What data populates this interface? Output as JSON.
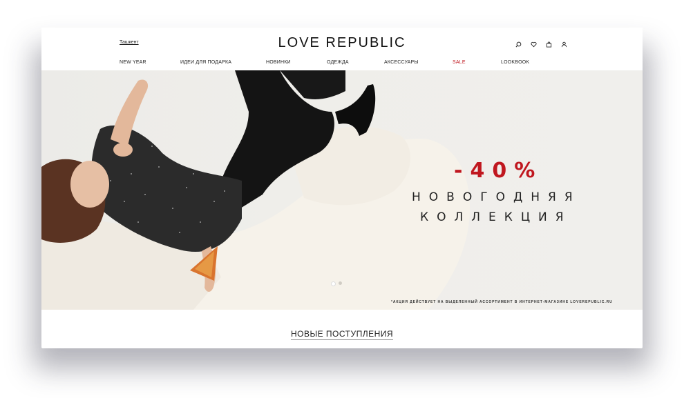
{
  "header": {
    "city": "Ташкент",
    "logo": "LOVE REPUBLIC"
  },
  "icons": [
    "search-icon",
    "heart-icon",
    "bag-icon",
    "user-icon"
  ],
  "nav": [
    {
      "label": "NEW YEAR",
      "sale": false
    },
    {
      "label": "ИДЕИ ДЛЯ ПОДАРКА",
      "sale": false
    },
    {
      "label": "НОВИНКИ",
      "sale": false
    },
    {
      "label": "ОДЕЖДА",
      "sale": false
    },
    {
      "label": "АКСЕССУАРЫ",
      "sale": false
    },
    {
      "label": "SALE",
      "sale": true
    },
    {
      "label": "LOOKBOOK",
      "sale": false
    }
  ],
  "banner": {
    "discount": "-40%",
    "line1": "НОВОГОДНЯЯ",
    "line2": "КОЛЛЕКЦИЯ",
    "disclaimer": "*АКЦИЯ ДЕЙСТВУЕТ НА ВЫДЕЛЕННЫЙ АССОРТИМЕНТ В ИНТЕРНЕТ-МАГАЗИНЕ LOVEREPUBLIC.RU",
    "slides": 2,
    "active_slide": 1
  },
  "section": {
    "title": "НОВЫЕ ПОСТУПЛЕНИЯ"
  },
  "colors": {
    "accent_red": "#c0171f",
    "text": "#222222"
  }
}
